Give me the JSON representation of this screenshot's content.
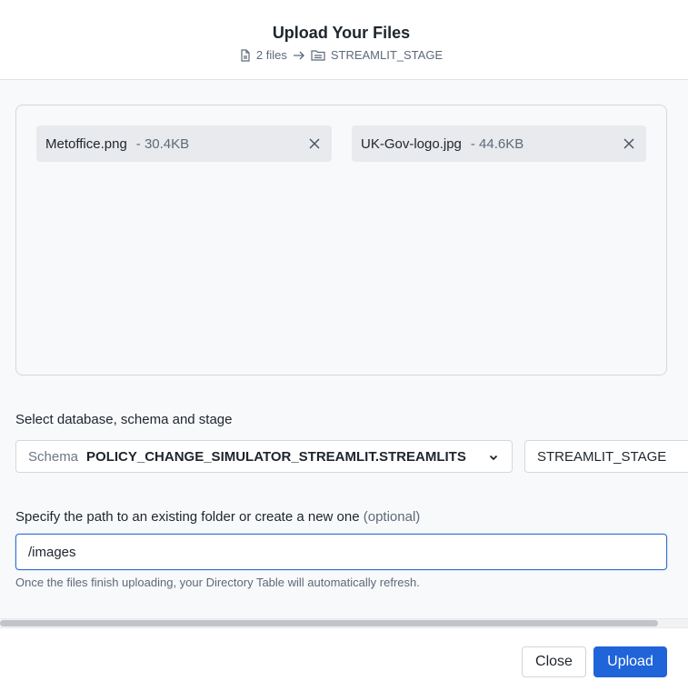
{
  "dialog": {
    "title": "Upload Your Files",
    "file_count": "2 files",
    "destination": "STREAMLIT_STAGE"
  },
  "files": [
    {
      "name": "Metoffice.png",
      "size": "- 30.4KB"
    },
    {
      "name": "UK-Gov-logo.jpg",
      "size": "- 44.6KB"
    }
  ],
  "location": {
    "label": "Select database, schema and stage",
    "schema_prefix": "Schema",
    "schema_value": "POLICY_CHANGE_SIMULATOR_STREAMLIT.STREAMLITS",
    "stage_value": "STREAMLIT_STAGE"
  },
  "path": {
    "label": "Specify the path to an existing folder or create a new one",
    "optional": "(optional)",
    "value": "/images",
    "helper": "Once the files finish uploading, your Directory Table will automatically refresh."
  },
  "footer": {
    "close_label": "Close",
    "upload_label": "Upload"
  },
  "colors": {
    "primary": "#1f64d8",
    "focus_border": "#2f6fd6",
    "muted_text": "#5d6a7a"
  },
  "icons": {
    "file": "file-icon",
    "arrow": "arrow-right-icon",
    "folder": "folder-stage-icon",
    "remove": "close-icon",
    "dropdown": "chevron-down-icon"
  }
}
